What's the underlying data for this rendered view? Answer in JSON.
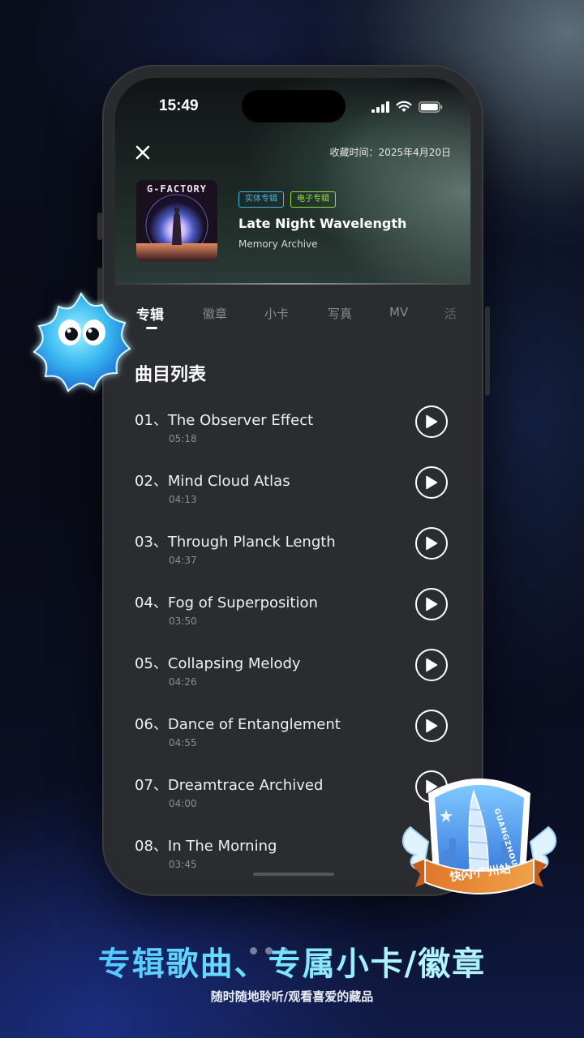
{
  "status_bar": {
    "time": "15:49"
  },
  "header": {
    "favorite_time": "收藏时间：2025年4月20日"
  },
  "album": {
    "cover_title": "G-FACTORY",
    "tags": [
      {
        "label": "实体专辑",
        "color": "#3fb7e8"
      },
      {
        "label": "电子专辑",
        "color": "#8fe03a"
      }
    ],
    "name": "Late Night Wavelength",
    "artist": "Memory Archive"
  },
  "tabs": [
    {
      "label": "专辑",
      "active": true
    },
    {
      "label": "徽章",
      "active": false
    },
    {
      "label": "小卡",
      "active": false
    },
    {
      "label": "写真",
      "active": false
    },
    {
      "label": "MV",
      "active": false
    },
    {
      "label": "活",
      "active": false
    }
  ],
  "tracklist": {
    "title": "曲目列表",
    "tracks": [
      {
        "title": "01、The Observer Effect",
        "duration": "05:18"
      },
      {
        "title": "02、Mind Cloud Atlas",
        "duration": "04:13"
      },
      {
        "title": "03、Through Planck Length",
        "duration": "04:37"
      },
      {
        "title": "04、Fog of Superposition",
        "duration": "03:50"
      },
      {
        "title": "05、Collapsing Melody",
        "duration": "04:26"
      },
      {
        "title": "06、Dance of Entanglement",
        "duration": "04:55"
      },
      {
        "title": "07、Dreamtrace Archived",
        "duration": "04:00"
      },
      {
        "title": "08、In The Morning",
        "duration": "03:45"
      }
    ]
  },
  "promo": {
    "headline": "专辑歌曲、专属小卡/徽章",
    "subtitle": "随时随地聆听/观看喜爱的藏品",
    "badge_text": "快闪·广州站",
    "badge_city": "GUANGZHOU"
  },
  "colors": {
    "accent_blue": "#40b8ff",
    "tag_blue": "#3fb7e8",
    "tag_green": "#8fe03a",
    "screen_bg": "#2b2c30"
  }
}
